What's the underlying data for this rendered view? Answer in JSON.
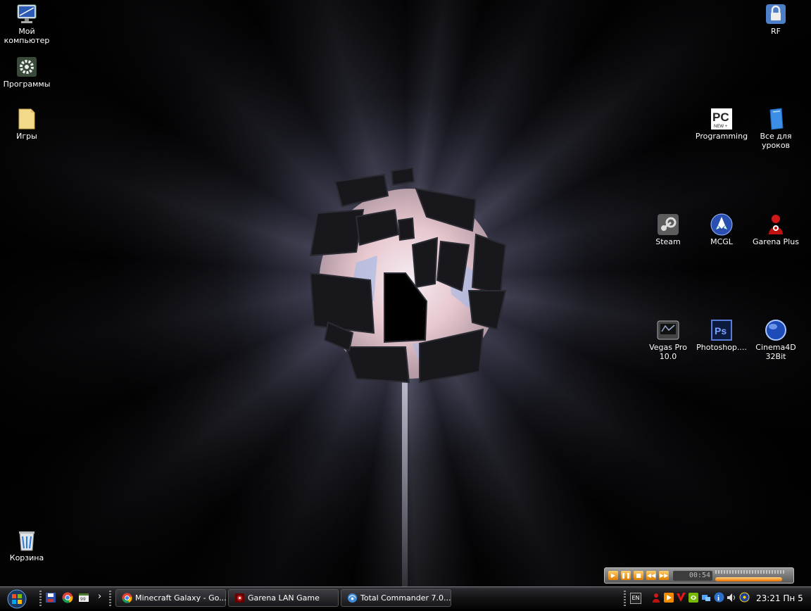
{
  "desktop": {
    "icons": [
      {
        "label": "Мой компьютер",
        "icon": "computer-icon"
      },
      {
        "label": "Программы",
        "icon": "gear-folder-icon"
      },
      {
        "label": "Игры",
        "icon": "folder-icon"
      },
      {
        "label": "Корзина",
        "icon": "recycle-bin-icon"
      },
      {
        "label": "RF",
        "icon": "lock-folder-icon"
      },
      {
        "label": "Programming",
        "icon": "pc-magazine-icon"
      },
      {
        "label": "Все для уроков",
        "icon": "blue-book-icon"
      },
      {
        "label": "Steam",
        "icon": "steam-icon"
      },
      {
        "label": "MCGL",
        "icon": "rocket-icon"
      },
      {
        "label": "Garena Plus",
        "icon": "garena-icon"
      },
      {
        "label": "Vegas Pro 10.0",
        "icon": "vegas-icon"
      },
      {
        "label": "Photoshop....",
        "icon": "photoshop-icon"
      },
      {
        "label": "Cinema4D 32Bit",
        "icon": "cinema4d-icon"
      }
    ]
  },
  "player": {
    "time": "00:54",
    "buttons": [
      "play",
      "pause",
      "stop",
      "prev",
      "next"
    ],
    "progress": 0.95
  },
  "taskbar": {
    "quick_launch": [
      "save-icon",
      "chrome-icon",
      "notepad-icon"
    ],
    "more": "›",
    "tasks": [
      {
        "label": "Minecraft Galaxy - Go...",
        "icon": "chrome-icon"
      },
      {
        "label": "Garena LAN Game",
        "icon": "garena-icon"
      },
      {
        "label": "Total Commander 7.0...",
        "icon": "total-commander-icon"
      }
    ],
    "language": "EN",
    "clock": "23:21 Пн 5"
  },
  "colors": {
    "taskbar": "#141416",
    "accent_orange": "#e07d00",
    "ps_blue": "#2a3f8f"
  }
}
